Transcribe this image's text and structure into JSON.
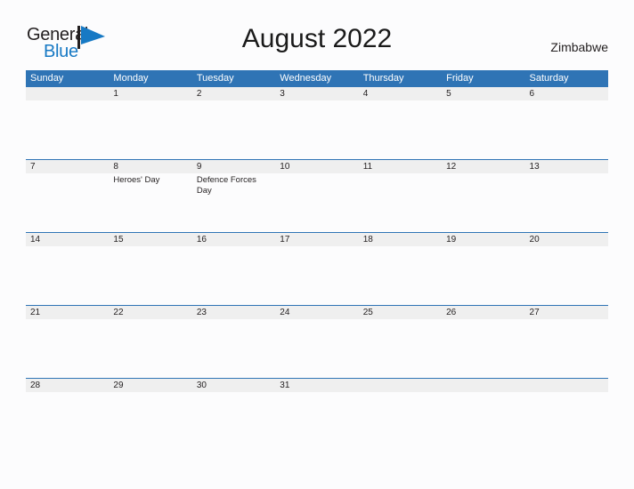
{
  "brand": {
    "name_part1": "General",
    "name_part2": "Blue",
    "flag_icon": "blue-flag-triangle-icon",
    "color_dark": "#231f20",
    "color_blue": "#1779c4"
  },
  "header": {
    "title": "August 2022",
    "country": "Zimbabwe"
  },
  "theme": {
    "header_blue": "#2f74b5",
    "date_band_gray": "#efefef",
    "page_background": "#fcfcfd",
    "text_color": "#231f20"
  },
  "calendar": {
    "month": "August",
    "year": "2022",
    "weekday_headers": [
      "Sunday",
      "Monday",
      "Tuesday",
      "Wednesday",
      "Thursday",
      "Friday",
      "Saturday"
    ],
    "weeks": [
      {
        "dates": [
          "",
          "1",
          "2",
          "3",
          "4",
          "5",
          "6"
        ],
        "events": [
          "",
          "",
          "",
          "",
          "",
          "",
          ""
        ]
      },
      {
        "dates": [
          "7",
          "8",
          "9",
          "10",
          "11",
          "12",
          "13"
        ],
        "events": [
          "",
          "Heroes' Day",
          "Defence Forces Day",
          "",
          "",
          "",
          ""
        ]
      },
      {
        "dates": [
          "14",
          "15",
          "16",
          "17",
          "18",
          "19",
          "20"
        ],
        "events": [
          "",
          "",
          "",
          "",
          "",
          "",
          ""
        ]
      },
      {
        "dates": [
          "21",
          "22",
          "23",
          "24",
          "25",
          "26",
          "27"
        ],
        "events": [
          "",
          "",
          "",
          "",
          "",
          "",
          ""
        ]
      },
      {
        "dates": [
          "28",
          "29",
          "30",
          "31",
          "",
          "",
          ""
        ],
        "events": [
          "",
          "",
          "",
          "",
          "",
          "",
          ""
        ]
      }
    ]
  }
}
